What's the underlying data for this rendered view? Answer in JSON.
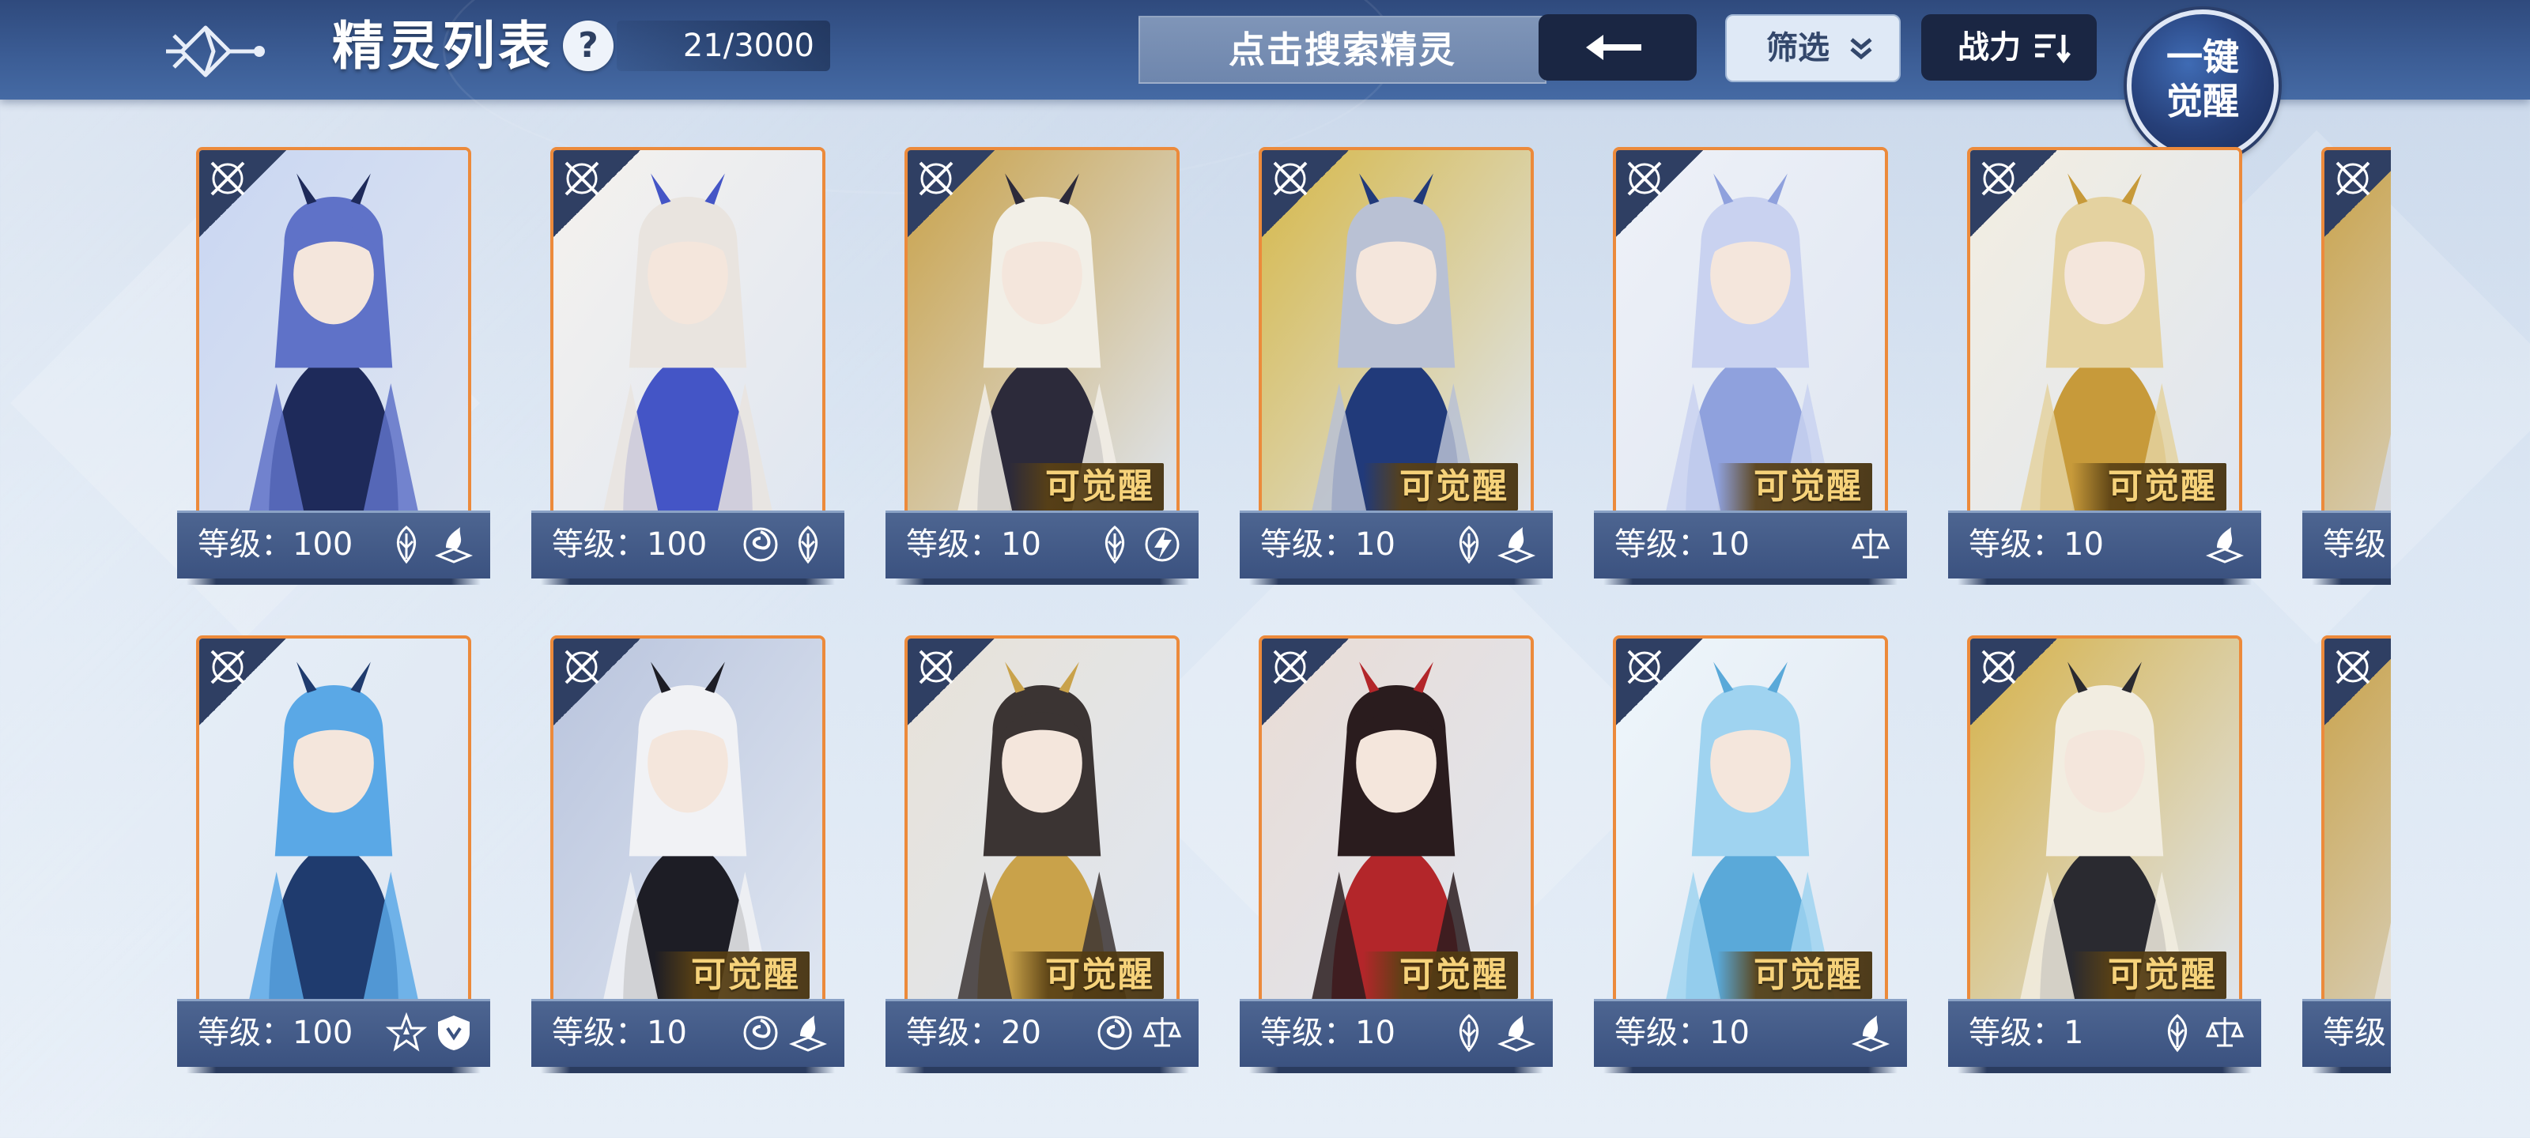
{
  "header": {
    "title": "精灵列表",
    "help_label": "?",
    "count": "21/3000",
    "search_placeholder": "点击搜索精灵",
    "filter_label": "筛选",
    "sort_label": "战力",
    "awaken_label_line1": "一键",
    "awaken_label_line2": "觉醒"
  },
  "awaken_badge": "可觉醒",
  "level_prefix": "等级",
  "cards": [
    {
      "level": "等级：100",
      "awakenable": false,
      "attrs": [
        "leaf-icon",
        "book-icon"
      ],
      "palette": [
        "#5f72c8",
        "#1e2a5a",
        "#c9d6f2"
      ]
    },
    {
      "level": "等级：100",
      "awakenable": false,
      "attrs": [
        "vortex-icon",
        "leaf-icon"
      ],
      "palette": [
        "#e9e4df",
        "#4455c6",
        "#f5f2ee"
      ]
    },
    {
      "level": "等级：10",
      "awakenable": true,
      "attrs": [
        "leaf-icon",
        "lightning-icon"
      ],
      "palette": [
        "#f2efe7",
        "#2c2a3a",
        "#c9a24a"
      ]
    },
    {
      "level": "等级：10",
      "awakenable": true,
      "attrs": [
        "leaf-icon",
        "book-icon"
      ],
      "palette": [
        "#b9c1d4",
        "#213a7a",
        "#d6b84a"
      ]
    },
    {
      "level": "等级：10",
      "awakenable": true,
      "attrs": [
        "scale-icon"
      ],
      "palette": [
        "#c9d2f0",
        "#8fa1dd",
        "#eef1f8"
      ]
    },
    {
      "level": "等级：10",
      "awakenable": true,
      "attrs": [
        "book-icon"
      ],
      "palette": [
        "#e4d2a0",
        "#c79a3a",
        "#f3eee1"
      ]
    },
    {
      "level": "等级",
      "awakenable": false,
      "attrs": [],
      "palette": [
        "#d6dbe4",
        "#222632",
        "#c9a24a"
      ]
    },
    {
      "level": "等级：100",
      "awakenable": false,
      "attrs": [
        "star-icon",
        "shield-icon"
      ],
      "palette": [
        "#5aa8e6",
        "#1f3b6e",
        "#e5eef7"
      ]
    },
    {
      "level": "等级：10",
      "awakenable": true,
      "attrs": [
        "vortex-icon",
        "book-icon"
      ],
      "palette": [
        "#f1f2f5",
        "#1d1d25",
        "#b9c4dd"
      ]
    },
    {
      "level": "等级：20",
      "awakenable": true,
      "attrs": [
        "vortex-icon",
        "scale-icon"
      ],
      "palette": [
        "#3b3433",
        "#c9a24a",
        "#e8e2d8"
      ]
    },
    {
      "level": "等级：10",
      "awakenable": true,
      "attrs": [
        "leaf-icon",
        "book-icon"
      ],
      "palette": [
        "#2a1c1e",
        "#b3262a",
        "#e9dcd5"
      ]
    },
    {
      "level": "等级：10",
      "awakenable": true,
      "attrs": [
        "book-icon"
      ],
      "palette": [
        "#9fd3f0",
        "#5aa9d9",
        "#eef6fb"
      ]
    },
    {
      "level": "等级：1",
      "awakenable": true,
      "attrs": [
        "leaf-icon",
        "scale-icon"
      ],
      "palette": [
        "#f2ede1",
        "#2a2a30",
        "#d6b24a"
      ]
    },
    {
      "level": "等级",
      "awakenable": false,
      "attrs": [],
      "palette": [
        "#e6e3dc",
        "#2a2a30",
        "#c9a24a"
      ]
    }
  ]
}
